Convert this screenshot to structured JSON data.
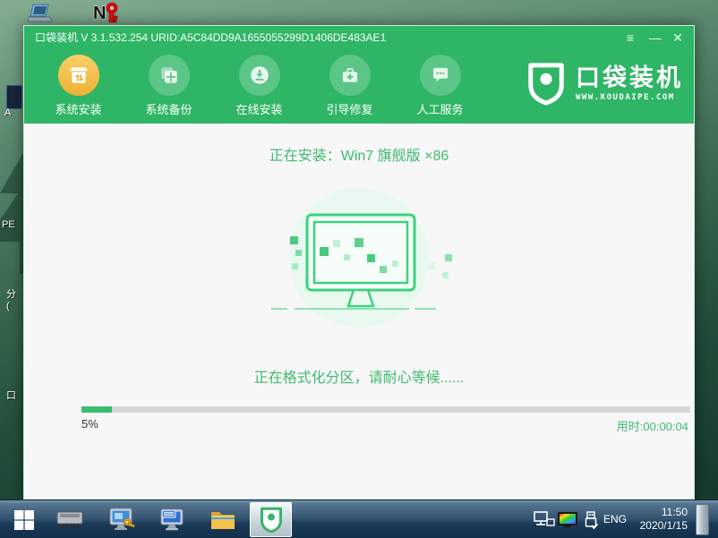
{
  "desktop": {
    "partial_labels": [
      "A",
      "PE",
      "分",
      "(",
      "口"
    ],
    "icons": [
      "laptop-icon",
      "n-red-key-icon",
      "tree-silhouette",
      "partial-desktop-icon"
    ]
  },
  "window": {
    "titlebar": {
      "title": "口袋装机 V 3.1.532.254 URID:A5C84DD9A1655055299D1406DE483AE1",
      "menu_glyph": "≡",
      "minimize_glyph": "—",
      "close_glyph": "✕"
    },
    "nav": [
      {
        "label": "系统安装",
        "active": true,
        "icon": "software-box-icon"
      },
      {
        "label": "系统备份",
        "active": false,
        "icon": "backup-windows-icon"
      },
      {
        "label": "在线安装",
        "active": false,
        "icon": "download-circle-icon"
      },
      {
        "label": "引导修复",
        "active": false,
        "icon": "toolbox-plus-icon"
      },
      {
        "label": "人工服务",
        "active": false,
        "icon": "chat-bubble-icon"
      }
    ],
    "logo": {
      "title": "口袋装机",
      "site": "WWW.KOUDAIPE.COM",
      "icon": "shield-dot-icon"
    },
    "main": {
      "heading": "正在安装：Win7 旗舰版 ×86",
      "status": "正在格式化分区，请耐心等候......",
      "progress_percent_label": "5%",
      "progress_value": 5,
      "elapsed": "用时:00:00:04"
    }
  },
  "taskbar": {
    "buttons": [
      "start-button",
      "memory-chip-app",
      "display-lock-app",
      "display-keyboard-app",
      "file-explorer-app",
      "pocket-installer-app"
    ],
    "tray": {
      "language": "ENG",
      "time": "11:50",
      "date": "2020/1/15"
    }
  },
  "colors": {
    "accent_green": "#2eb566",
    "active_yellow": "#f0bb3f",
    "inactive_circle": "#5cc588",
    "content_bg": "#f7f7f7",
    "progress_fill": "#3bbd70",
    "taskbar_blue": "#1c3b58",
    "desktop_green": "#2c5a44"
  }
}
